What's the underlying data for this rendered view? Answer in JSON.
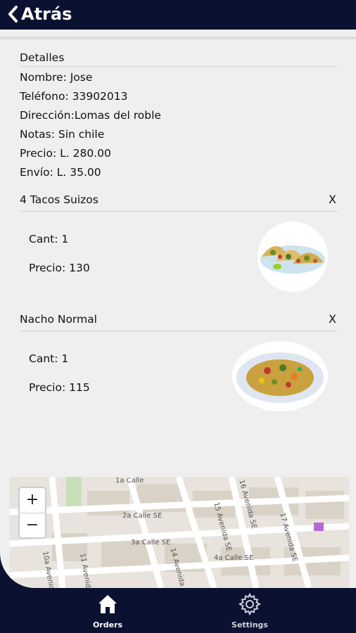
{
  "header": {
    "back_label": "Atrás"
  },
  "details": {
    "title": "Detalles",
    "name": "Nombre: Jose",
    "phone": "Teléfono: 33902013",
    "address": "Dirección:Lomas del roble",
    "notes": "Notas: Sin chile",
    "price": "Precio: L. 280.00",
    "shipping": "Envío: L. 35.00"
  },
  "items": [
    {
      "name": "4 Tacos Suizos",
      "remove": "X",
      "qty": "Cant: 1",
      "price": "Precio: 130",
      "image": "tacos-image"
    },
    {
      "name": "Nacho Normal",
      "remove": "X",
      "qty": "Cant: 1",
      "price": "Precio: 115",
      "image": "nachos-image"
    }
  ],
  "map": {
    "zoom_in": "+",
    "zoom_out": "−",
    "streets": [
      "1a Calle",
      "2a Calle SE",
      "3a Calle SE",
      "4a Calle SE",
      "14 Avenida SE",
      "15 Avenida SE",
      "16 Avenida SE",
      "17 Avenida SE",
      "11 Avenida",
      "10a Avenida",
      "9a Avenida"
    ]
  },
  "nav": [
    {
      "label": "Orders",
      "icon": "home-icon"
    },
    {
      "label": "Settings",
      "icon": "gear-icon"
    }
  ],
  "colors": {
    "header": "#0b1130",
    "background": "#efefef"
  }
}
